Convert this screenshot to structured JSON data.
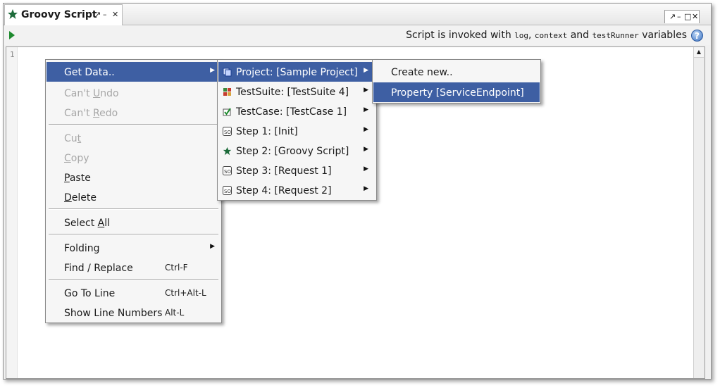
{
  "tab": {
    "title": "Groovy Script",
    "detach_icon": "↗",
    "minimize_icon": "–",
    "close_icon": "✕"
  },
  "window_controls": {
    "detach": "↗",
    "minimize": "–",
    "maximize": "□",
    "close": "✕"
  },
  "toolbar": {
    "run_icon": "play-icon",
    "invoke_prefix": "Script is invoked with ",
    "var_log": "log",
    "sep_comma": ", ",
    "var_context": "context",
    "sep_and": " and ",
    "var_testrunner": "testRunner",
    "invoke_suffix": " variables",
    "help_label": "?"
  },
  "editor": {
    "line_numbers": [
      "1"
    ]
  },
  "context_menu": {
    "items": [
      {
        "label": "Get Data..",
        "enabled": true,
        "submenu": true,
        "highlighted": true
      },
      {
        "label_pre": "Can't ",
        "mnemonic": "U",
        "label_post": "ndo",
        "enabled": false
      },
      {
        "label_pre": "Can't ",
        "mnemonic": "R",
        "label_post": "edo",
        "enabled": false
      },
      {
        "label_pre": "Cu",
        "mnemonic": "t",
        "label_post": "",
        "enabled": false
      },
      {
        "label_pre": "",
        "mnemonic": "C",
        "label_post": "opy",
        "enabled": false
      },
      {
        "label_pre": "",
        "mnemonic": "P",
        "label_post": "aste",
        "enabled": true
      },
      {
        "label_pre": "",
        "mnemonic": "D",
        "label_post": "elete",
        "enabled": true
      },
      {
        "label_pre": "Select ",
        "mnemonic": "A",
        "label_post": "ll",
        "enabled": true
      },
      {
        "label": "Folding",
        "enabled": true,
        "submenu": true
      },
      {
        "label": "Find / Replace",
        "shortcut": "Ctrl-F",
        "enabled": true
      },
      {
        "label": "Go To Line",
        "shortcut": "Ctrl+Alt-L",
        "enabled": true
      },
      {
        "label": "Show Line Numbers",
        "shortcut": "Alt-L",
        "enabled": true
      }
    ]
  },
  "data_menu": {
    "items": [
      {
        "label": "Project: [Sample Project]",
        "icon": "project-icon",
        "highlighted": true
      },
      {
        "label": "TestSuite: [TestSuite 4]",
        "icon": "testsuite-icon"
      },
      {
        "label": "TestCase: [TestCase 1]",
        "icon": "testcase-icon"
      },
      {
        "label": "Step 1: [Init]",
        "icon": "request-step-icon"
      },
      {
        "label": "Step 2: [Groovy Script]",
        "icon": "groovy-star-icon"
      },
      {
        "label": "Step 3: [Request 1]",
        "icon": "request-step-icon"
      },
      {
        "label": "Step 4: [Request 2]",
        "icon": "request-step-icon"
      }
    ]
  },
  "property_menu": {
    "items": [
      {
        "label": "Create new.."
      },
      {
        "label": "Property [ServiceEndpoint]",
        "highlighted": true
      }
    ]
  },
  "colors": {
    "highlight": "#3e5fa3",
    "disabled_text": "#a7a7a7",
    "groovy_star": "#1d6b3a"
  }
}
